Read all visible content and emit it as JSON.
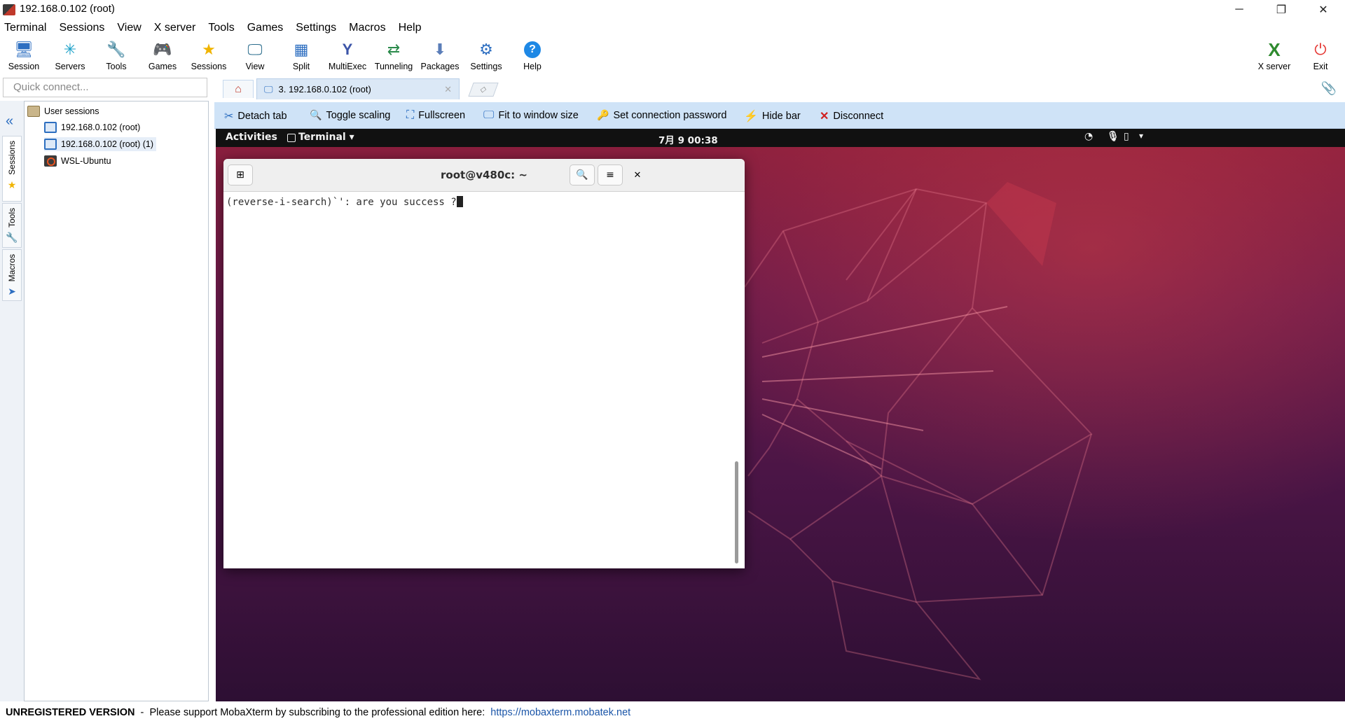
{
  "window": {
    "title": "192.168.0.102 (root)",
    "controls": {
      "minimize": "─",
      "restore": "❐",
      "close": "✕"
    }
  },
  "menu": [
    "Terminal",
    "Sessions",
    "View",
    "X server",
    "Tools",
    "Games",
    "Settings",
    "Macros",
    "Help"
  ],
  "toolbar": {
    "left": [
      {
        "label": "Session",
        "icon": "session-icon",
        "glyph": "🖥"
      },
      {
        "label": "Servers",
        "icon": "servers-icon",
        "glyph": "✳"
      },
      {
        "label": "Tools",
        "icon": "tools-icon",
        "glyph": "🔧"
      },
      {
        "label": "Games",
        "icon": "games-icon",
        "glyph": "🎮"
      },
      {
        "label": "Sessions",
        "icon": "sessions-star-icon",
        "glyph": "★"
      },
      {
        "label": "View",
        "icon": "view-icon",
        "glyph": "🖵"
      },
      {
        "label": "Split",
        "icon": "split-icon",
        "glyph": "▦"
      },
      {
        "label": "MultiExec",
        "icon": "multiexec-icon",
        "glyph": "Y"
      },
      {
        "label": "Tunneling",
        "icon": "tunneling-icon",
        "glyph": "⇄"
      },
      {
        "label": "Packages",
        "icon": "packages-icon",
        "glyph": "⬇"
      },
      {
        "label": "Settings",
        "icon": "settings-icon",
        "glyph": "⚙"
      },
      {
        "label": "Help",
        "icon": "help-icon",
        "glyph": "?"
      }
    ],
    "right": [
      {
        "label": "X server",
        "icon": "x-server-icon",
        "glyph": "X"
      },
      {
        "label": "Exit",
        "icon": "power-icon",
        "glyph": "⏻"
      }
    ]
  },
  "quick_connect": {
    "placeholder": "Quick connect..."
  },
  "tabs": {
    "home_icon": "home-icon",
    "session_tab": {
      "label": "3. 192.168.0.102 (root)",
      "close": "✕"
    },
    "new_tab_glyph": "◇"
  },
  "side_tabs": [
    {
      "label": "Sessions",
      "icon": "star-icon",
      "glyph": "★"
    },
    {
      "label": "Tools",
      "icon": "tools-icon",
      "glyph": "🔧"
    },
    {
      "label": "Macros",
      "icon": "macros-icon",
      "glyph": "➤"
    }
  ],
  "sessions_tree": {
    "root": "User sessions",
    "items": [
      {
        "label": "192.168.0.102 (root)",
        "type": "rdp"
      },
      {
        "label": "192.168.0.102 (root) (1)",
        "type": "rdp",
        "selected": true
      },
      {
        "label": "WSL-Ubuntu",
        "type": "wsl"
      }
    ]
  },
  "action_bar": [
    {
      "label": "Detach tab",
      "icon": "scissors-icon",
      "glyph": "✂",
      "color": "#2e6fc1"
    },
    {
      "label": "Toggle scaling",
      "icon": "magnifier-icon",
      "glyph": "🔍",
      "color": "#2e6fc1"
    },
    {
      "label": "Fullscreen",
      "icon": "fullscreen-icon",
      "glyph": "⛶",
      "color": "#2e6fc1"
    },
    {
      "label": "Fit to window size",
      "icon": "fit-window-icon",
      "glyph": "🖵",
      "color": "#2e6fc1"
    },
    {
      "label": "Set connection password",
      "icon": "key-icon",
      "glyph": "🔑",
      "color": "#d9901a"
    },
    {
      "label": "Hide bar",
      "icon": "lightning-icon",
      "glyph": "⚡",
      "color": "#c020c0"
    },
    {
      "label": "Disconnect",
      "icon": "disconnect-icon",
      "glyph": "✕",
      "color": "#d02020"
    }
  ],
  "remote": {
    "topbar": {
      "activities": "Activities",
      "app_menu": "Terminal ▾",
      "clock": "7月 9  00:38",
      "tray": [
        "wifi-icon",
        "mic-icon",
        "battery-icon",
        "menu-arrow-icon"
      ]
    },
    "terminal_window": {
      "title": "root@v480c: ~",
      "body_line": "(reverse-i-search)`': are you success ?"
    }
  },
  "status_bar": {
    "version": "UNREGISTERED VERSION",
    "separator": "  -  ",
    "message": "Please support MobaXterm by subscribing to the professional edition here:",
    "link": "https://mobaxterm.mobatek.net"
  },
  "colors": {
    "action_bar_bg": "#cfe3f7",
    "desktop_top": "#8e1f3c",
    "desktop_bottom": "#2d0f33",
    "link": "#1a55a8"
  }
}
